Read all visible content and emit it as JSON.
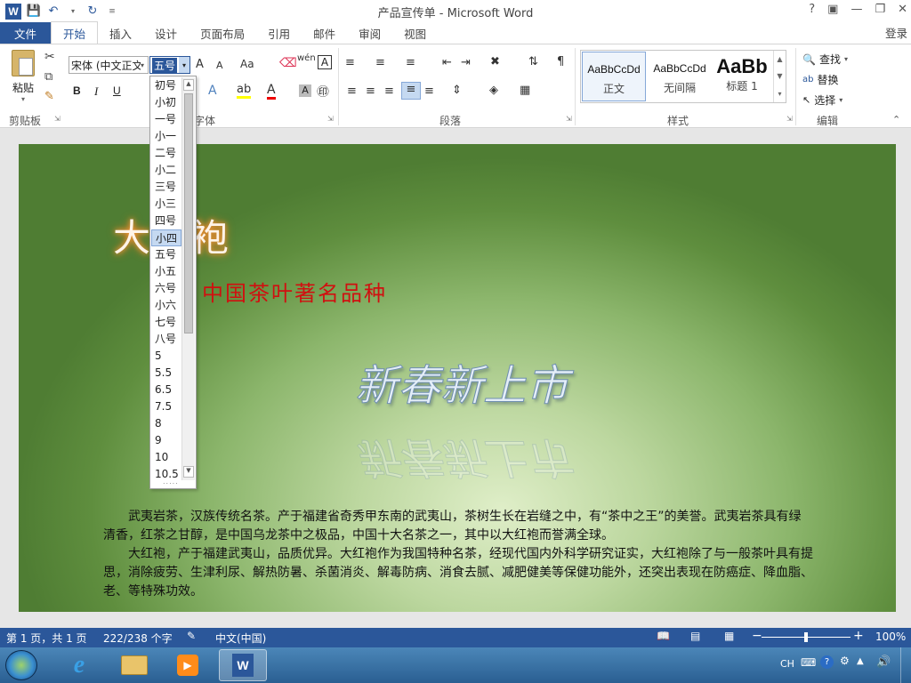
{
  "window": {
    "title": "产品宣传单 - Microsoft Word",
    "help": "?",
    "login": "登录"
  },
  "tabs": [
    "文件",
    "开始",
    "插入",
    "设计",
    "页面布局",
    "引用",
    "邮件",
    "审阅",
    "视图"
  ],
  "clipboard": {
    "paste": "粘贴",
    "label": "剪贴板"
  },
  "font": {
    "name": "宋体 (中文正文)",
    "size": "五号",
    "label": "字体",
    "bold": "B",
    "italic": "I",
    "underline": "U",
    "grow": "A",
    "shrink": "A",
    "case": "Aa",
    "pinyin": "wén",
    "border_char": "A"
  },
  "paragraph": {
    "label": "段落"
  },
  "styles": {
    "label": "样式",
    "items": [
      {
        "sample": "AaBbCcDd",
        "name": "正文"
      },
      {
        "sample": "AaBbCcDd",
        "name": "无间隔"
      },
      {
        "sample": "AaBb",
        "name": "标题 1"
      }
    ]
  },
  "editing": {
    "label": "编辑",
    "find": "查找",
    "replace": "替换",
    "select": "选择"
  },
  "size_dropdown": {
    "items": [
      "初号",
      "小初",
      "一号",
      "小一",
      "二号",
      "小二",
      "三号",
      "小三",
      "四号",
      "小四",
      "五号",
      "小五",
      "六号",
      "小六",
      "七号",
      "八号",
      "5",
      "5.5",
      "6.5",
      "7.5",
      "8",
      "9",
      "10",
      "10.5"
    ],
    "highlighted": "小四",
    "more": "....."
  },
  "document": {
    "title": "大红袍",
    "subtitle": "中国茶叶著名品种",
    "slogan": "新春新上市",
    "lines": [
      "武夷岩茶，汉族传统名茶。产于福建省奇秀甲东南的武夷山，茶树生长在岩缝之中，有“茶中之王”的美誉。武夷岩茶具有绿",
      "清香，红茶之甘醇，是中国乌龙茶中之极品，中国十大名茶之一，其中以大红袍而誉满全球。",
      "大红袍，产于福建武夷山，品质优异。大红袍作为我国特种名茶，经现代国内外科学研究证实，大红袍除了与一般茶叶具有提",
      "思，消除疲劳、生津利尿、解热防暑、杀菌消炎、解毒防病、消食去腻、减肥健美等保健功能外，还突出表现在防癌症、降血脂、",
      "老、等特殊功效。"
    ]
  },
  "status": {
    "page": "第 1 页，共 1 页",
    "words": "222/238 个字",
    "lang": "中文(中国)",
    "zoom": "100%"
  },
  "taskbar": {
    "ime": "CH"
  },
  "colors": {
    "accent": "#2b579a",
    "title_glow": "#ff8a2c",
    "subtitle": "#d01010"
  }
}
